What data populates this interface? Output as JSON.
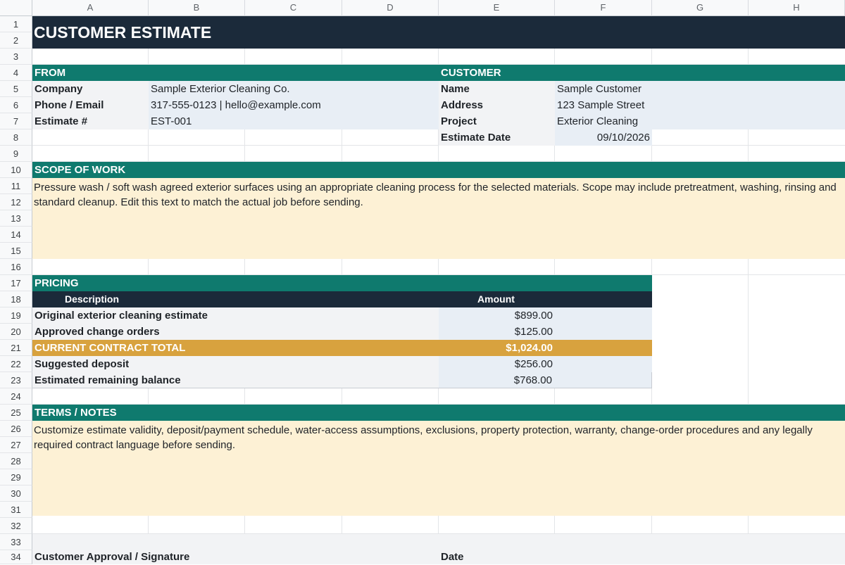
{
  "columns": [
    "A",
    "B",
    "C",
    "D",
    "E",
    "F",
    "G",
    "H"
  ],
  "rows": [
    "1",
    "2",
    "3",
    "4",
    "5",
    "6",
    "7",
    "8",
    "9",
    "10",
    "11",
    "12",
    "13",
    "14",
    "15",
    "16",
    "17",
    "18",
    "19",
    "20",
    "21",
    "22",
    "23",
    "24",
    "25",
    "26",
    "27",
    "28",
    "29",
    "30",
    "31",
    "32",
    "33",
    "34"
  ],
  "title": "CUSTOMER ESTIMATE",
  "from": {
    "header": "FROM",
    "rows": [
      {
        "label": "Company",
        "value": "Sample Exterior Cleaning Co."
      },
      {
        "label": "Phone / Email",
        "value": "317-555-0123 | hello@example.com"
      },
      {
        "label": "Estimate #",
        "value": "EST-001"
      }
    ]
  },
  "customer": {
    "header": "CUSTOMER",
    "rows": [
      {
        "label": "Name",
        "value": "Sample Customer"
      },
      {
        "label": "Address",
        "value": "123 Sample Street"
      },
      {
        "label": "Project",
        "value": "Exterior Cleaning"
      },
      {
        "label": "Estimate Date",
        "value": "09/10/2026"
      }
    ]
  },
  "scope": {
    "header": "SCOPE OF WORK",
    "text": "Pressure wash / soft wash agreed exterior surfaces using an appropriate cleaning process for the selected materials. Scope may include pretreatment, washing, rinsing and standard cleanup. Edit this text to match the actual job before sending."
  },
  "pricing": {
    "header": "PRICING",
    "col_description": "Description",
    "col_amount": "Amount",
    "rows": [
      {
        "description": "Original exterior cleaning estimate",
        "amount": "$899.00"
      },
      {
        "description": "Approved change orders",
        "amount": "$125.00"
      },
      {
        "description": "CURRENT CONTRACT TOTAL",
        "amount": "$1,024.00"
      },
      {
        "description": "Suggested deposit",
        "amount": "$256.00"
      },
      {
        "description": "Estimated remaining balance",
        "amount": "$768.00"
      }
    ]
  },
  "terms": {
    "header": "TERMS / NOTES",
    "text": "Customize estimate validity, deposit/payment schedule, water-access assumptions, exclusions, property protection, warranty, change-order procedures and any legally required contract language before sending."
  },
  "signature": {
    "approval_label": "Customer Approval / Signature",
    "date_label": "Date"
  },
  "colors": {
    "navy": "#1b2a3a",
    "teal": "#0f7a6e",
    "gold": "#d8a23e",
    "cream": "#fdf1d5",
    "light_blue": "#e8eef5",
    "light_gray": "#f2f3f5"
  }
}
